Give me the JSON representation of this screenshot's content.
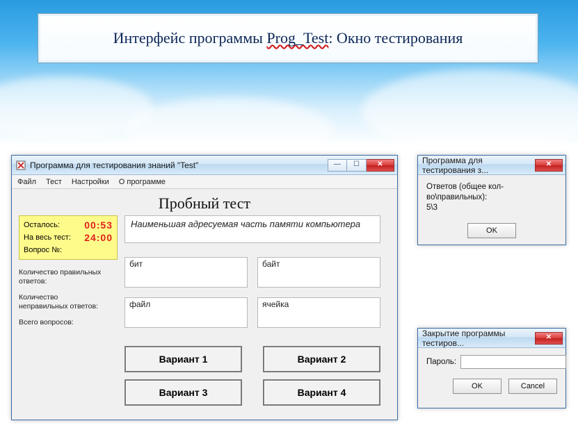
{
  "slide": {
    "title_prefix": "Интерфейс программы ",
    "title_mid": "Prog_Test",
    "title_suffix": ": Окно тестирования"
  },
  "main_window": {
    "title": "Программа для тестирования знаний \"Test\"",
    "menu": [
      "Файл",
      "Тест",
      "Настройки",
      "О программе"
    ],
    "heading": "Пробный тест",
    "timer": {
      "remaining_label": "Осталось:",
      "remaining_value": "00:53",
      "total_label": "На весь тест:",
      "total_value": "24:00",
      "question_label": "Вопрос №:",
      "question_value": ""
    },
    "stats": {
      "correct_label": "Количество правильных ответов:",
      "correct_value": "",
      "wrong_label": "Количество неправильных ответов:",
      "wrong_value": "",
      "total_label": "Всего вопросов:",
      "total_value": ""
    },
    "question_text": "Наименьшая адресуемая часть памяти компьютера",
    "answers": [
      "бит",
      "байт",
      "файл",
      "ячейка"
    ],
    "variants": [
      "Вариант 1",
      "Вариант 2",
      "Вариант 3",
      "Вариант 4"
    ]
  },
  "results_dialog": {
    "title": "Программа для тестирования з...",
    "message_line1": "Ответов (общее кол-во\\правильных):",
    "message_line2": "5\\3",
    "ok": "OK"
  },
  "close_dialog": {
    "title": "Закрытие программы тестиров...",
    "password_label": "Пароль:",
    "password_value": "",
    "ok": "OK",
    "cancel": "Cancel"
  }
}
